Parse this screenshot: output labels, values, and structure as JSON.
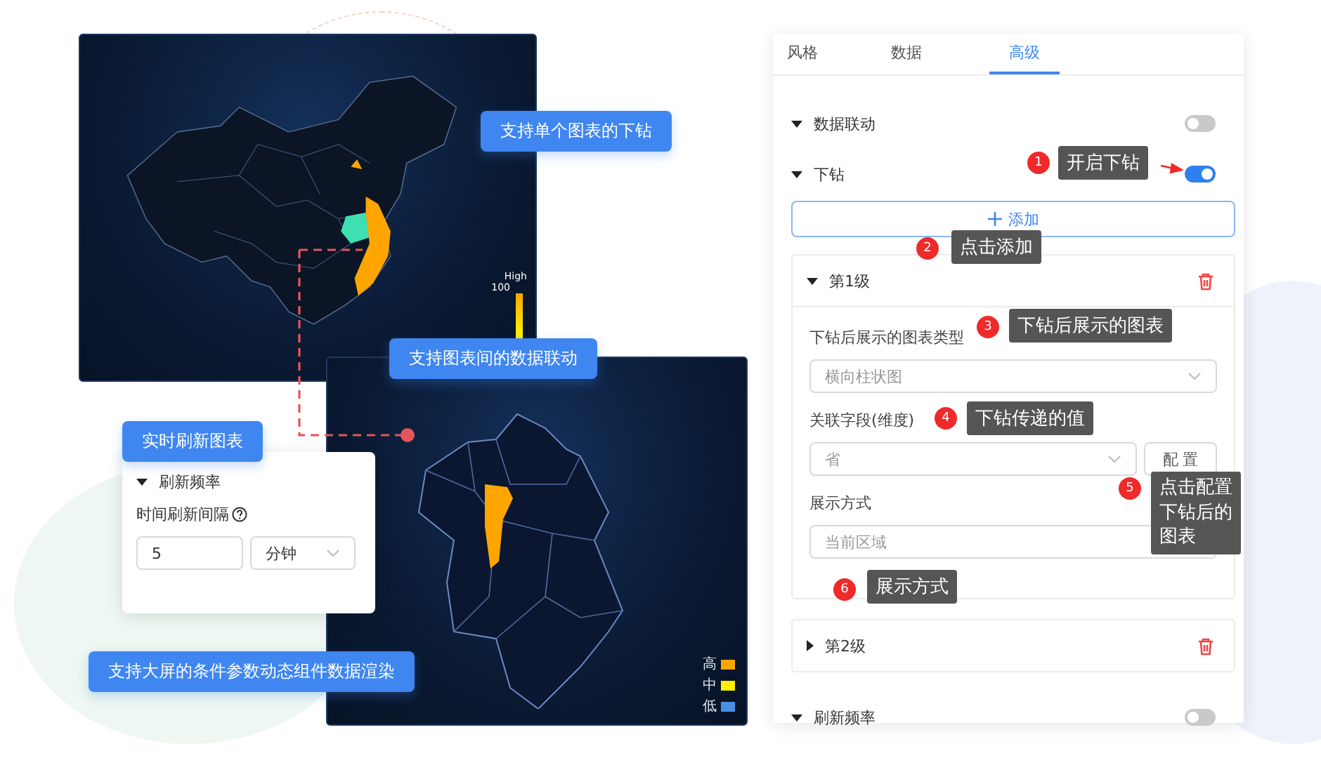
{
  "callouts": [
    {
      "text": "支持单个图表的下钻"
    },
    {
      "text": "支持图表间的数据联动"
    },
    {
      "text": "实时刷新图表"
    },
    {
      "text": "支持大屏的条件参数动态组件数据渲染"
    }
  ],
  "map_main": {
    "legend": {
      "max": "100",
      "label": "High"
    }
  },
  "map_drill": {
    "legend": [
      {
        "label": "高",
        "color": "#ffa500"
      },
      {
        "label": "中",
        "color": "#ffee00"
      },
      {
        "label": "低",
        "color": "#4a90e2"
      }
    ]
  },
  "refresh_card": {
    "section": "刷新频率",
    "expanded": true,
    "field_label": "时间刷新间隔",
    "value": "5",
    "unit": "分钟"
  },
  "panel": {
    "tabs": [
      {
        "label": "风格",
        "selected": false
      },
      {
        "label": "数据",
        "selected": false
      },
      {
        "label": "高级",
        "selected": true
      }
    ],
    "drill_sections": [
      {
        "label": "数据联动",
        "expanded": true,
        "on": false
      },
      {
        "label": "下钻",
        "expanded": true,
        "on": true
      }
    ],
    "add_button": "添加",
    "levels": [
      {
        "title": "第1级",
        "expanded": true,
        "fields": [
          {
            "label": "下钻后展示的图表类型",
            "placeholder": "横向柱状图"
          },
          {
            "label": "关联字段(维度)",
            "placeholder": "省",
            "button": "配 置"
          },
          {
            "label": "展示方式",
            "placeholder": "当前区域"
          }
        ]
      },
      {
        "title": "第2级",
        "expanded": false
      }
    ],
    "refresh_section": {
      "label": "刷新频率",
      "expanded": true,
      "on": false
    }
  },
  "annotations": [
    {
      "number": "1",
      "text": "开启下钻"
    },
    {
      "number": "2",
      "text": "点击添加"
    },
    {
      "number": "3",
      "text": "下钻后展示的图表"
    },
    {
      "number": "4",
      "text": "下钻传递的值"
    },
    {
      "number": "5",
      "text": "点击配置下钻后的图表"
    },
    {
      "number": "6",
      "text": "展示方式"
    }
  ]
}
